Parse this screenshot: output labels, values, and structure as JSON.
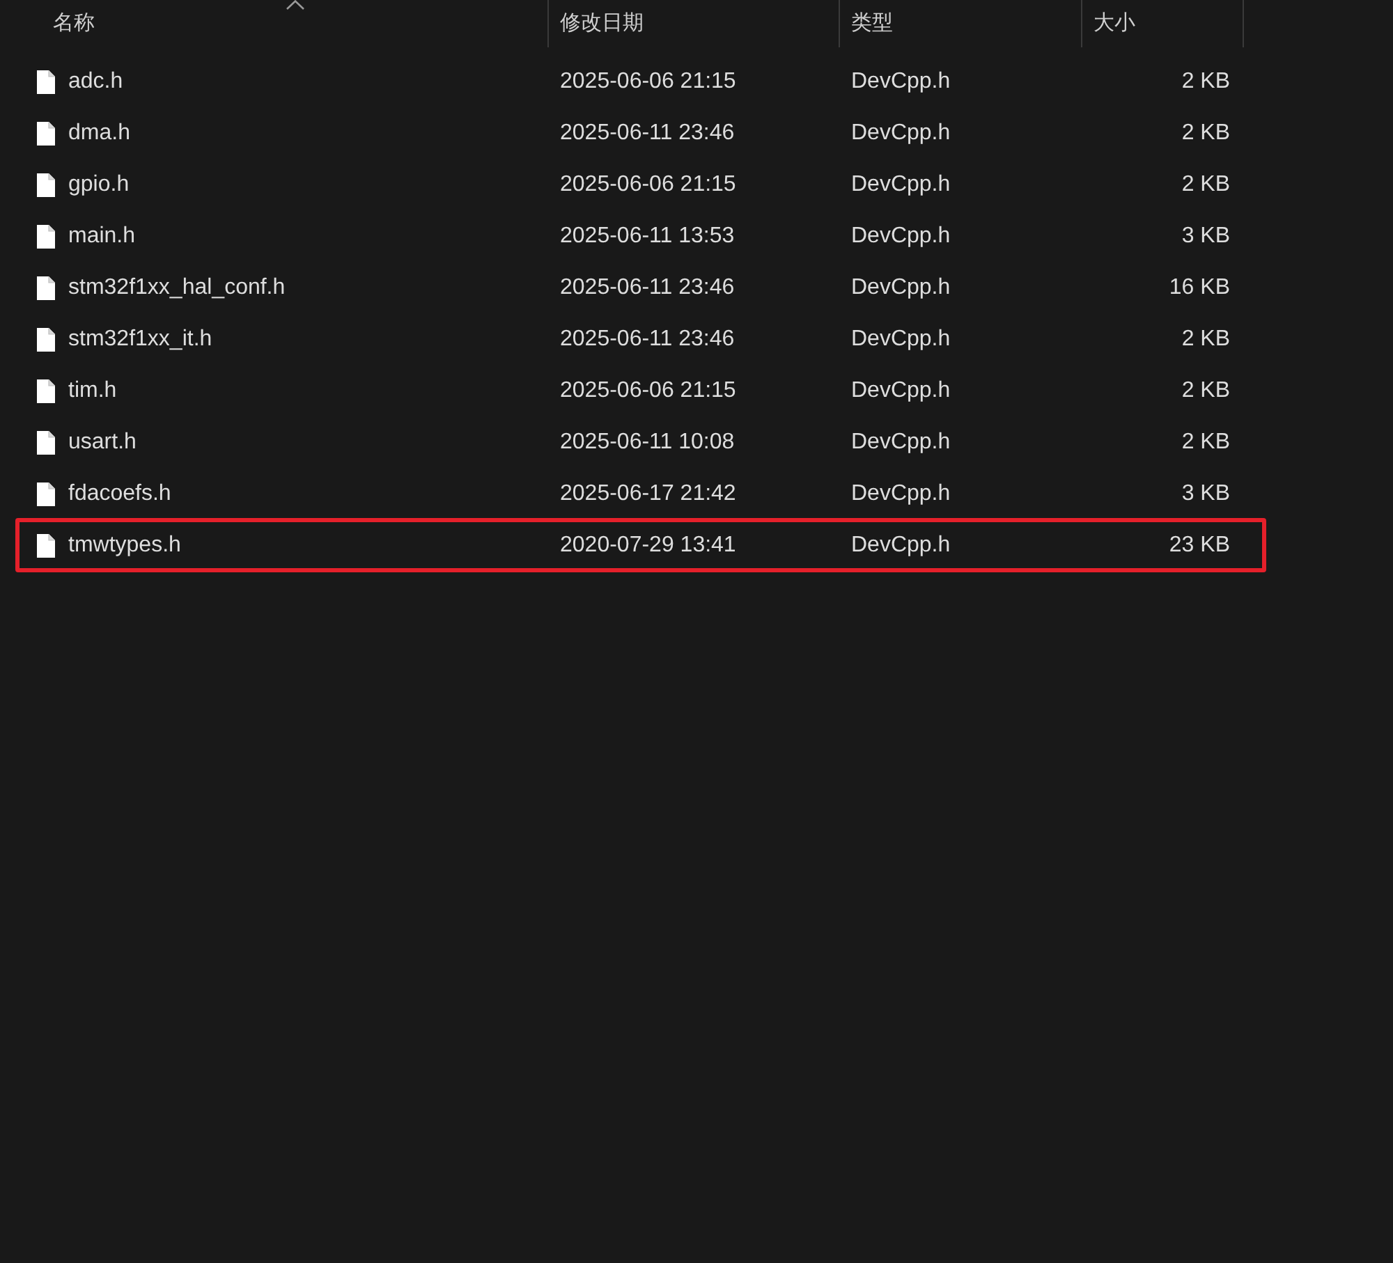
{
  "columns": [
    {
      "label": "名称",
      "sorted": true
    },
    {
      "label": "修改日期",
      "sorted": false
    },
    {
      "label": "类型",
      "sorted": false
    },
    {
      "label": "大小",
      "sorted": false
    }
  ],
  "rows": [
    {
      "name": "adc.h",
      "modified": "2025-06-06 21:15",
      "type": "DevCpp.h",
      "size": "2 KB",
      "highlighted": false
    },
    {
      "name": "dma.h",
      "modified": "2025-06-11 23:46",
      "type": "DevCpp.h",
      "size": "2 KB",
      "highlighted": false
    },
    {
      "name": "gpio.h",
      "modified": "2025-06-06 21:15",
      "type": "DevCpp.h",
      "size": "2 KB",
      "highlighted": false
    },
    {
      "name": "main.h",
      "modified": "2025-06-11 13:53",
      "type": "DevCpp.h",
      "size": "3 KB",
      "highlighted": false
    },
    {
      "name": "stm32f1xx_hal_conf.h",
      "modified": "2025-06-11 23:46",
      "type": "DevCpp.h",
      "size": "16 KB",
      "highlighted": false
    },
    {
      "name": "stm32f1xx_it.h",
      "modified": "2025-06-11 23:46",
      "type": "DevCpp.h",
      "size": "2 KB",
      "highlighted": false
    },
    {
      "name": "tim.h",
      "modified": "2025-06-06 21:15",
      "type": "DevCpp.h",
      "size": "2 KB",
      "highlighted": false
    },
    {
      "name": "usart.h",
      "modified": "2025-06-11 10:08",
      "type": "DevCpp.h",
      "size": "2 KB",
      "highlighted": false
    },
    {
      "name": "fdacoefs.h",
      "modified": "2025-06-17 21:42",
      "type": "DevCpp.h",
      "size": "3 KB",
      "highlighted": false
    },
    {
      "name": "tmwtypes.h",
      "modified": "2020-07-29 13:41",
      "type": "DevCpp.h",
      "size": "23 KB",
      "highlighted": true
    }
  ]
}
